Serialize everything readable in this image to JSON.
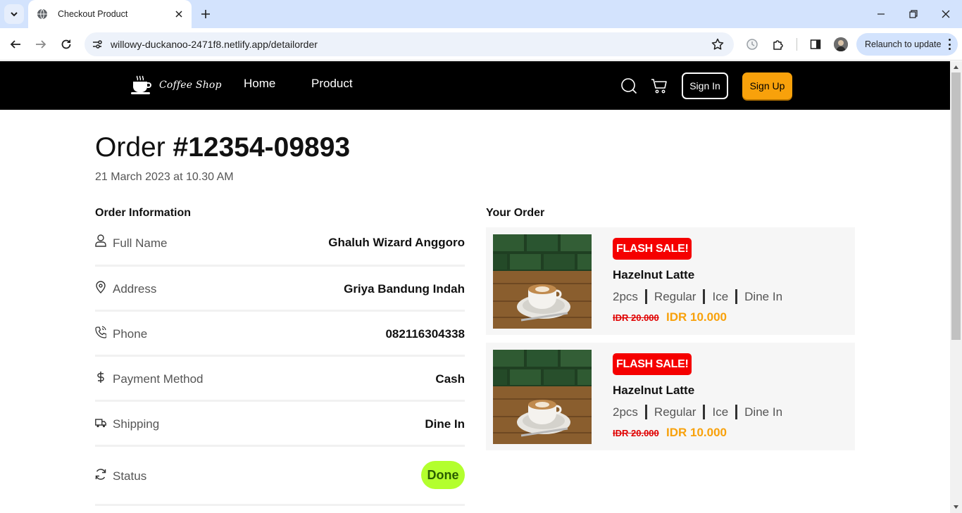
{
  "browser": {
    "tab_title": "Checkout Product",
    "url": "willowy-duckanoo-2471f8.netlify.app/detailorder",
    "relaunch_label": "Relaunch to update"
  },
  "site": {
    "logo_text": "Coffee Shop",
    "nav": {
      "home": "Home",
      "product": "Product"
    },
    "sign_in": "Sign In",
    "sign_up": "Sign Up"
  },
  "order": {
    "title_prefix": "Order",
    "number": "#12354-09893",
    "date": "21 March 2023 at 10.30 AM"
  },
  "info": {
    "heading": "Order Information",
    "rows": [
      {
        "label": "Full Name",
        "value": "Ghaluh Wizard Anggoro",
        "icon": "user-icon"
      },
      {
        "label": "Address",
        "value": "Griya Bandung Indah",
        "icon": "location-pin-icon"
      },
      {
        "label": "Phone",
        "value": "082116304338",
        "icon": "phone-icon"
      },
      {
        "label": "Payment Method",
        "value": "Cash",
        "icon": "dollar-icon"
      },
      {
        "label": "Shipping",
        "value": "Dine In",
        "icon": "truck-icon"
      },
      {
        "label": "Status",
        "value": "Done",
        "icon": "refresh-icon"
      }
    ]
  },
  "your_order": {
    "heading": "Your Order",
    "items": [
      {
        "badge": "FLASH SALE!",
        "name": "Hazelnut Latte",
        "qty": "2pcs",
        "size": "Regular",
        "temp": "Ice",
        "mode": "Dine In",
        "old_price": "IDR 20.000",
        "new_price": "IDR 10.000"
      },
      {
        "badge": "FLASH SALE!",
        "name": "Hazelnut Latte",
        "qty": "2pcs",
        "size": "Regular",
        "temp": "Ice",
        "mode": "Dine In",
        "old_price": "IDR 20.000",
        "new_price": "IDR 10.000"
      }
    ]
  },
  "colors": {
    "accent": "#f8a10b",
    "navbar": "#000000",
    "badge": "#f50000",
    "status": "#b3ff2e"
  }
}
